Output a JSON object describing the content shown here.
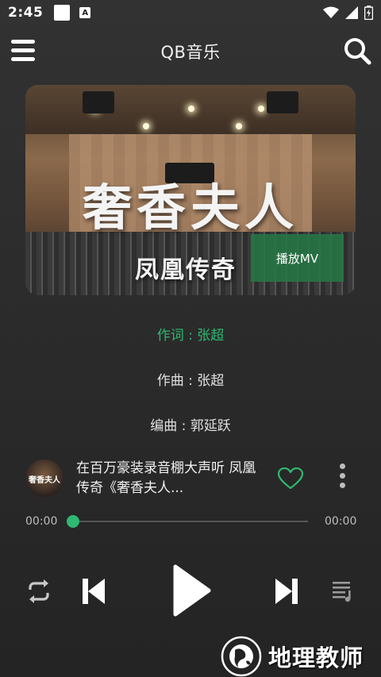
{
  "status_bar": {
    "time": "2:45",
    "notification_badge": "A",
    "icons": [
      "wifi-icon",
      "cell-signal-icon",
      "battery-charging-icon"
    ]
  },
  "app_bar": {
    "title": "QB音乐",
    "menu_icon": "hamburger-menu-icon",
    "search_icon": "search-icon"
  },
  "album": {
    "art_title": "奢香夫人",
    "art_subtitle": "凤凰传奇",
    "mv_button_label": "播放MV"
  },
  "lyrics": [
    {
      "text": "作词 : 张超",
      "active": true
    },
    {
      "text": "作曲 : 张超",
      "active": false
    },
    {
      "text": "编曲 : 郭延跃",
      "active": false
    }
  ],
  "now_playing": {
    "thumb_text": "奢香夫人",
    "title": "在百万豪装录音棚大声听 凤凰传奇《奢香夫人...",
    "favorite_icon": "heart-outline-icon",
    "more_icon": "more-vertical-icon"
  },
  "progress": {
    "current_time": "00:00",
    "total_time": "00:00",
    "fraction": 0.0
  },
  "controls": {
    "repeat_icon": "repeat-icon",
    "previous_icon": "skip-previous-icon",
    "play_icon": "play-icon",
    "next_icon": "skip-next-icon",
    "playlist_icon": "playlist-icon"
  },
  "watermark": {
    "text": "地理教师"
  },
  "colors": {
    "accent": "#2fb871",
    "background": "#2c2c2c",
    "mv_button": "#257945"
  }
}
